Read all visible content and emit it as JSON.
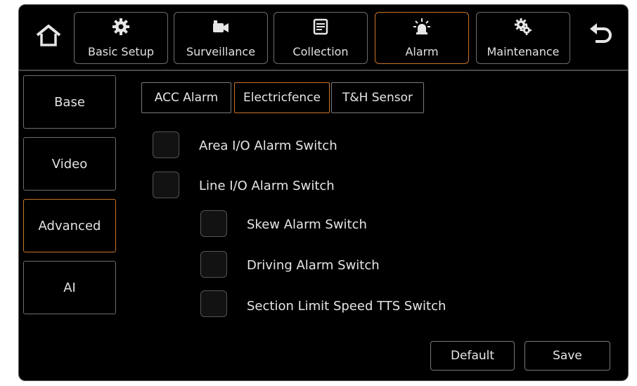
{
  "top_tabs": [
    {
      "label": "Basic Setup",
      "icon": "gear-icon"
    },
    {
      "label": "Surveillance",
      "icon": "camera-icon"
    },
    {
      "label": "Collection",
      "icon": "document-icon"
    },
    {
      "label": "Alarm",
      "icon": "siren-icon",
      "active": true
    },
    {
      "label": "Maintenance",
      "icon": "gears-icon"
    }
  ],
  "sidebar": {
    "items": [
      {
        "label": "Base"
      },
      {
        "label": "Video"
      },
      {
        "label": "Advanced",
        "active": true
      },
      {
        "label": "AI"
      }
    ]
  },
  "sub_tabs": [
    {
      "label": "ACC Alarm"
    },
    {
      "label": "Electricfence",
      "active": true
    },
    {
      "label": "T&H Sensor"
    }
  ],
  "options": [
    {
      "label": "Area I/O Alarm Switch",
      "checked": false
    },
    {
      "label": "Line I/O Alarm Switch",
      "checked": false
    },
    {
      "label": "Skew Alarm Switch",
      "checked": false
    },
    {
      "label": "Driving Alarm Switch",
      "checked": false
    },
    {
      "label": "Section Limit Speed TTS Switch",
      "checked": false
    }
  ],
  "buttons": {
    "default_label": "Default",
    "save_label": "Save"
  },
  "colors": {
    "accent": "#c8742a",
    "background": "#000000",
    "text": "#e6e6e6"
  }
}
